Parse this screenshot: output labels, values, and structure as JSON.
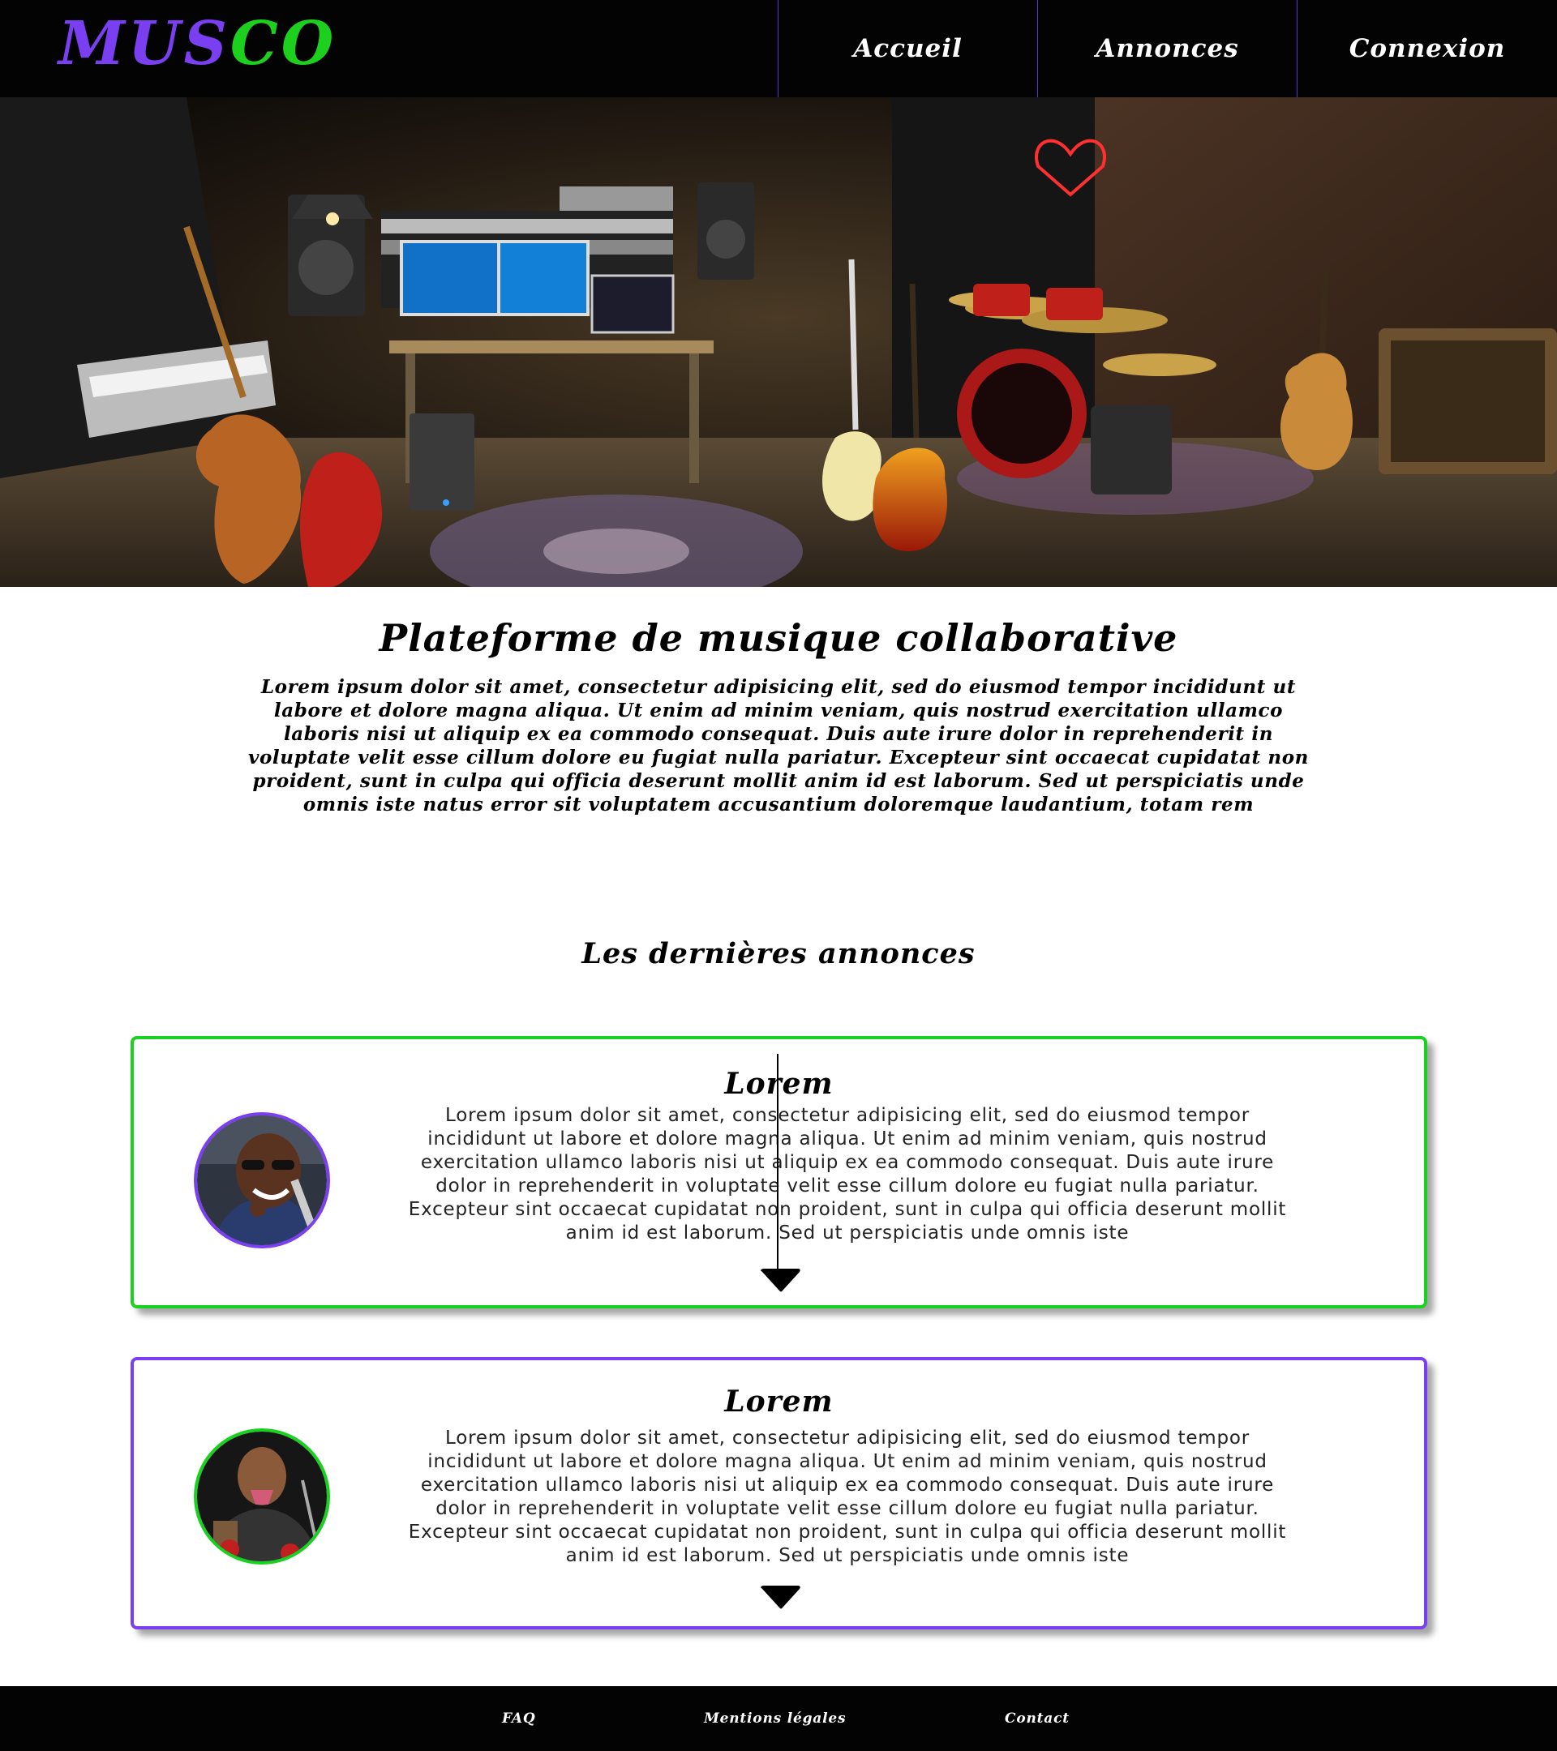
{
  "header": {
    "logo_part1": "MUS",
    "logo_part2": "CO",
    "nav": [
      {
        "label": "Accueil"
      },
      {
        "label": "Annonces"
      },
      {
        "label": "Connexion"
      }
    ]
  },
  "intro": {
    "title": "Plateforme de musique collaborative",
    "text": "Lorem ipsum dolor sit amet, consectetur adipisicing elit, sed do eiusmod tempor incididunt ut labore et dolore magna aliqua. Ut enim ad minim veniam, quis nostrud exercitation ullamco laboris nisi ut aliquip ex ea commodo consequat. Duis aute irure dolor in reprehenderit in voluptate velit esse cillum dolore eu fugiat nulla pariatur. Excepteur sint occaecat cupidatat non proident, sunt in culpa qui officia deserunt mollit anim id est laborum. Sed ut perspiciatis unde omnis iste natus error sit voluptatem accusantium doloremque laudantium, totam rem"
  },
  "announcements": {
    "title": "Les dernières annonces",
    "items": [
      {
        "title": "Lorem",
        "text": "Lorem ipsum dolor sit amet, consectetur adipisicing elit, sed do eiusmod tempor incididunt ut labore et dolore magna aliqua. Ut enim ad minim veniam, quis nostrud exercitation ullamco laboris nisi ut aliquip ex ea commodo consequat. Duis aute irure dolor in reprehenderit in voluptate velit esse cillum dolore eu fugiat nulla pariatur. Excepteur sint occaecat cupidatat non proident, sunt in culpa qui officia deserunt mollit anim id est laborum. Sed ut perspiciatis unde omnis iste",
        "border_color": "#19d11f"
      },
      {
        "title": "Lorem",
        "text": "Lorem ipsum dolor sit amet, consectetur adipisicing elit, sed do eiusmod tempor incididunt ut labore et dolore magna aliqua. Ut enim ad minim veniam, quis nostrud exercitation ullamco laboris nisi ut aliquip ex ea commodo consequat. Duis aute irure dolor in reprehenderit in voluptate velit esse cillum dolore eu fugiat nulla pariatur. Excepteur sint occaecat cupidatat non proident, sunt in culpa qui officia deserunt mollit anim id est laborum. Sed ut perspiciatis unde omnis iste",
        "border_color": "#7b3ff2"
      }
    ]
  },
  "footer": {
    "links": [
      {
        "label": "FAQ"
      },
      {
        "label": "Mentions légales"
      },
      {
        "label": "Contact"
      }
    ]
  },
  "colors": {
    "brand_purple": "#7b3ff2",
    "brand_green": "#1ed01e",
    "header_bg": "#030303"
  },
  "icons": [
    "chevron-down-icon"
  ]
}
